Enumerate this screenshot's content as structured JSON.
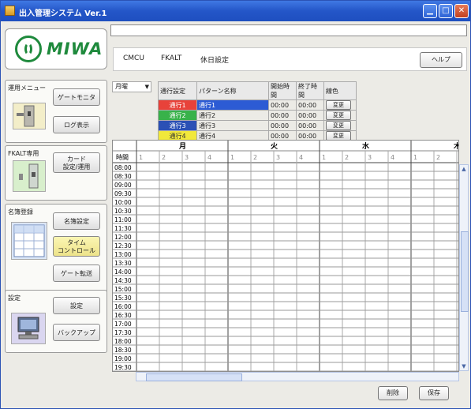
{
  "window": {
    "title": "出入管理システム  Ver.1"
  },
  "logo": {
    "brand": "MIWA"
  },
  "sidebar": {
    "groups": [
      {
        "label": "運用メニュー",
        "buttons": [
          "ゲートモニタ",
          "ログ表示"
        ]
      },
      {
        "label": "FKALT専用",
        "buttons": [
          "カード\n設定/運用"
        ]
      },
      {
        "label": "名簿登録",
        "buttons": [
          "名簿設定",
          "タイム\nコントロール",
          "ゲート転送"
        ]
      },
      {
        "label": "設定",
        "buttons": [
          "設定",
          "バックアップ"
        ]
      }
    ]
  },
  "tabs": [
    "CMCU",
    "FKALT",
    "休日設定"
  ],
  "help_label": "ヘルプ",
  "day_select": {
    "value": "月曜"
  },
  "pattern_table": {
    "headers": [
      "通行設定",
      "パターン名称",
      "開始時間",
      "終了時間",
      "線色"
    ],
    "rows": [
      {
        "setting": "通行1",
        "name": "通行1",
        "start": "00:00",
        "end": "00:00",
        "change": "変更",
        "color": "#e8423a"
      },
      {
        "setting": "通行2",
        "name": "通行2",
        "start": "00:00",
        "end": "00:00",
        "change": "変更",
        "color": "#38b24a"
      },
      {
        "setting": "通行3",
        "name": "通行3",
        "start": "00:00",
        "end": "00:00",
        "change": "変更",
        "color": "#2b50b5"
      },
      {
        "setting": "通行4",
        "name": "通行4",
        "start": "00:00",
        "end": "00:00",
        "change": "変更",
        "color": "#f1e83b"
      }
    ]
  },
  "schedule": {
    "time_header": "時間",
    "days": [
      "月",
      "火",
      "水",
      "木"
    ],
    "sub_cols": [
      "1",
      "2",
      "3",
      "4"
    ],
    "times": [
      "08:00",
      "08:30",
      "09:00",
      "09:30",
      "10:00",
      "10:30",
      "11:00",
      "11:30",
      "12:00",
      "12:30",
      "13:00",
      "13:30",
      "14:00",
      "14:30",
      "15:00",
      "15:30",
      "16:00",
      "16:30",
      "17:00",
      "17:30",
      "18:00",
      "18:30",
      "19:00",
      "19:30"
    ]
  },
  "footer": {
    "delete_label": "削除",
    "save_label": "保存"
  }
}
